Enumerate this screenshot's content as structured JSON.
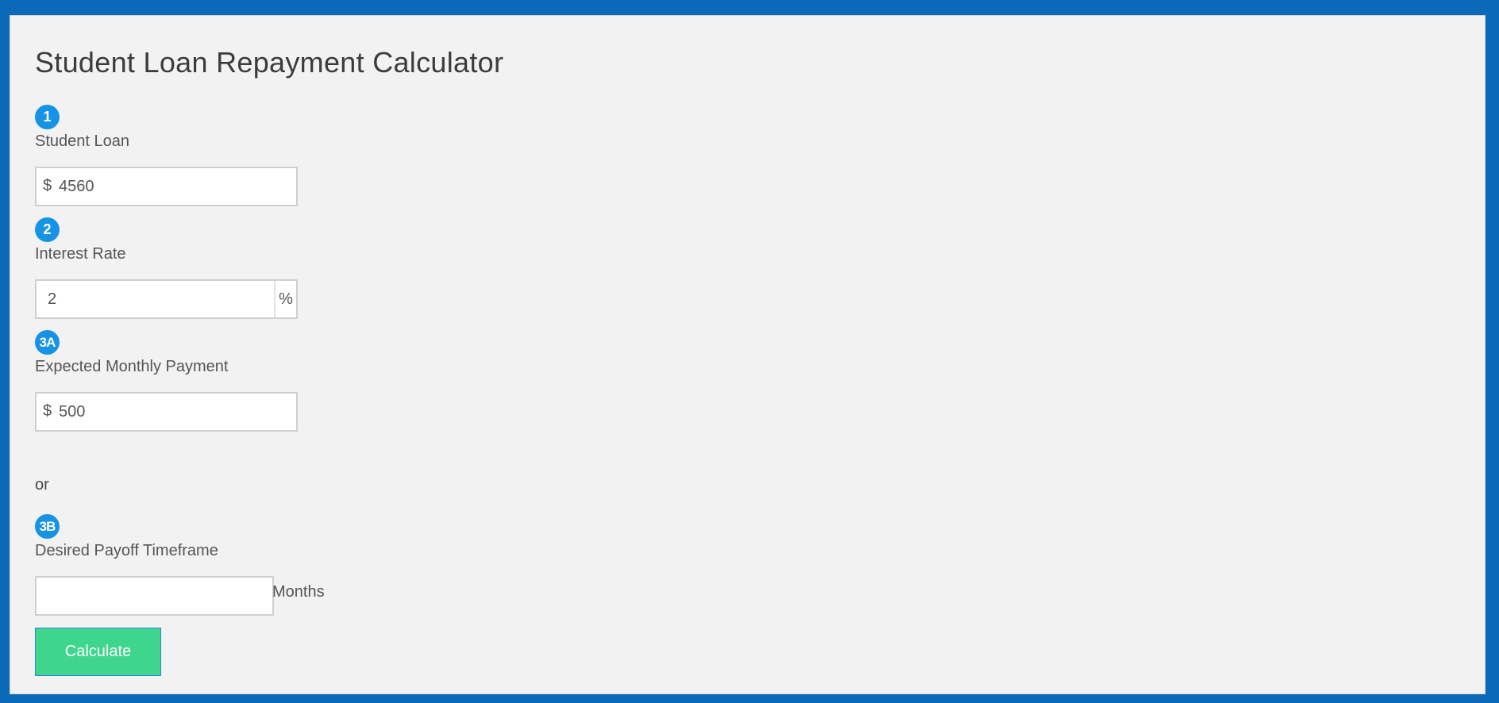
{
  "calculator": {
    "title": "Student Loan Repayment Calculator",
    "steps": {
      "loan": {
        "badge": "1",
        "label": "Student Loan",
        "prefix": "$",
        "value": "4560"
      },
      "rate": {
        "badge": "2",
        "label": "Interest Rate",
        "value": "2",
        "suffix": "%"
      },
      "payment": {
        "badge": "3A",
        "label": "Expected Monthly Payment",
        "prefix": "$",
        "value": "500"
      },
      "timeframe": {
        "badge": "3B",
        "label": "Desired Payoff Timeframe",
        "value": "",
        "unit": "Months"
      }
    },
    "or_text": "or",
    "calculate_label": "Calculate",
    "colors": {
      "frame": "#0a6ab8",
      "panel": "#f2f2f2",
      "badge": "#1793e6",
      "button": "#3dd68c"
    }
  }
}
